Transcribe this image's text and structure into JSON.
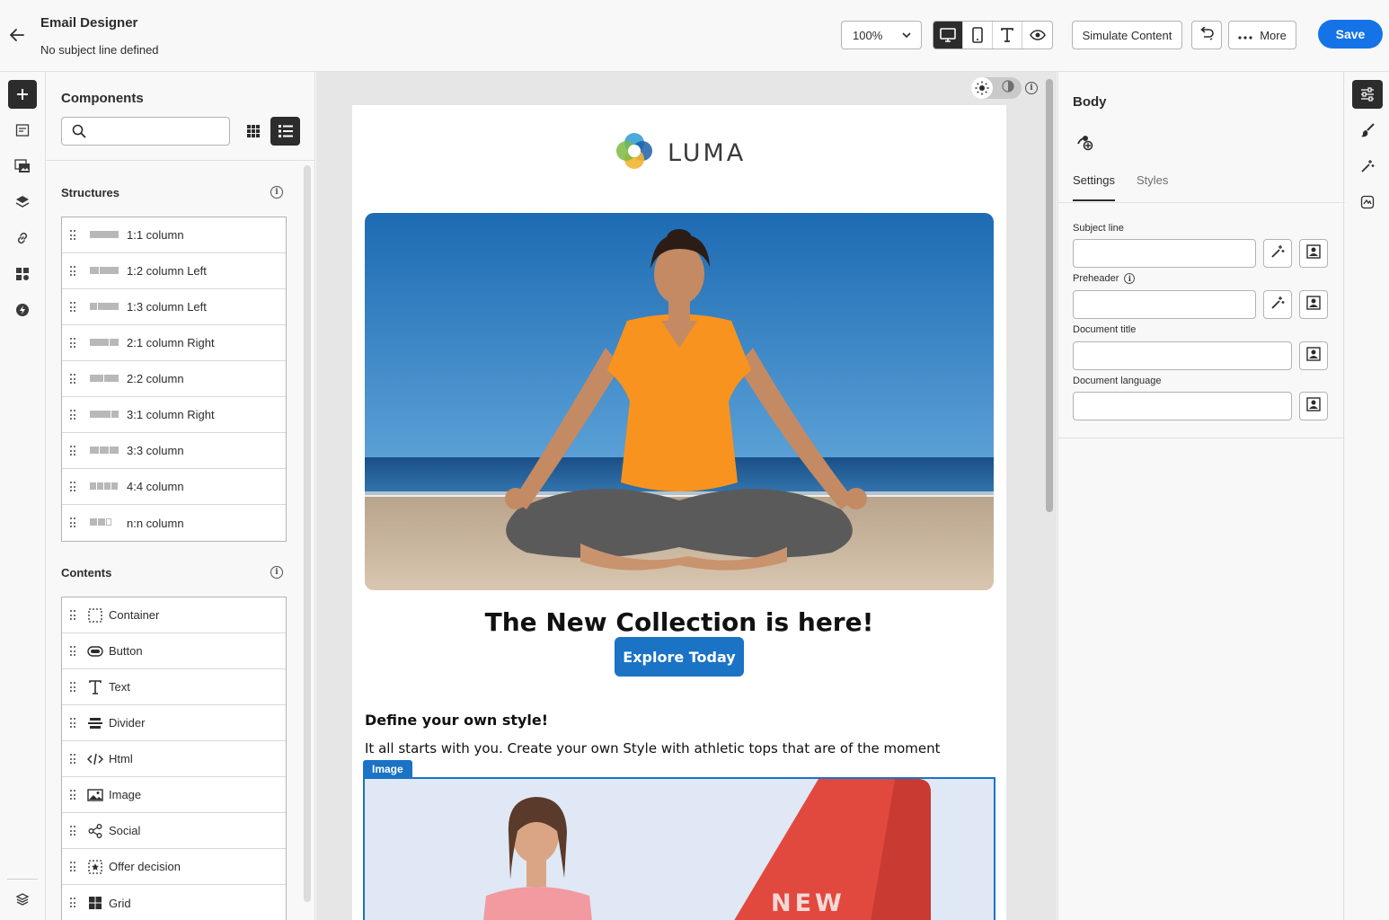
{
  "header": {
    "title": "Email Designer",
    "subtitle": "No subject line defined",
    "zoom": "100%",
    "simulate_label": "Simulate Content",
    "more_label": "More",
    "save_label": "Save"
  },
  "left_rail": {
    "icons": [
      "add-icon",
      "fragments-icon",
      "assets-icon",
      "layers-icon",
      "links-icon",
      "apps-icon",
      "dynamic-content-icon",
      "help-icon"
    ]
  },
  "components": {
    "title": "Components",
    "search_placeholder": "",
    "structures_title": "Structures",
    "structures": [
      {
        "label": "1:1 column"
      },
      {
        "label": "1:2 column Left"
      },
      {
        "label": "1:3 column Left"
      },
      {
        "label": "2:1 column Right"
      },
      {
        "label": "2:2 column"
      },
      {
        "label": "3:1 column Right"
      },
      {
        "label": "3:3 column"
      },
      {
        "label": "4:4 column"
      },
      {
        "label": "n:n column"
      }
    ],
    "contents_title": "Contents",
    "contents": [
      {
        "label": "Container",
        "icon": "container-icon"
      },
      {
        "label": "Button",
        "icon": "button-icon"
      },
      {
        "label": "Text",
        "icon": "text-icon"
      },
      {
        "label": "Divider",
        "icon": "divider-icon"
      },
      {
        "label": "Html",
        "icon": "code-icon"
      },
      {
        "label": "Image",
        "icon": "image-icon"
      },
      {
        "label": "Social",
        "icon": "share-icon"
      },
      {
        "label": "Offer decision",
        "icon": "offer-decision-icon"
      },
      {
        "label": "Grid",
        "icon": "grid-icon"
      }
    ]
  },
  "email": {
    "brand": "LUMA",
    "headline": "The New Collection is here!",
    "cta_label": "Explore Today",
    "subheading": "Define your own style!",
    "body_text": "It all starts with you. Create your own Style with athletic tops that are of the moment",
    "image_tag": "Image",
    "banner_text": "NEW"
  },
  "properties": {
    "title": "Body",
    "tabs": [
      "Settings",
      "Styles"
    ],
    "active_tab": "Settings",
    "fields": {
      "subject_line": {
        "label": "Subject line",
        "value": ""
      },
      "preheader": {
        "label": "Preheader",
        "value": ""
      },
      "document_title": {
        "label": "Document title",
        "value": ""
      },
      "document_language": {
        "label": "Document language",
        "value": ""
      }
    }
  },
  "colors": {
    "accent": "#1473e6",
    "cta": "#1a73c4",
    "dark": "#2c2c2c",
    "shirt": "#f7931e"
  }
}
